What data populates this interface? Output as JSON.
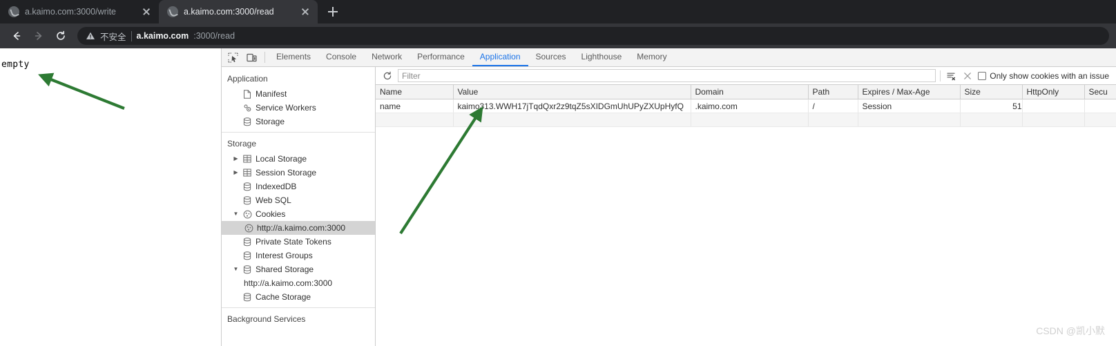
{
  "browser": {
    "tabs": [
      {
        "title": "a.kaimo.com:3000/write",
        "active": false,
        "favicon": "globe-icon"
      },
      {
        "title": "a.kaimo.com:3000/read",
        "active": true,
        "favicon": "globe-icon"
      }
    ],
    "new_tab_label": "+",
    "toolbar": {
      "back_label": "Back",
      "forward_label": "Forward",
      "reload_label": "Reload"
    },
    "omnibox": {
      "security_icon": "warning-triangle-icon",
      "security_label": "不安全",
      "url_host": "a.kaimo.com",
      "url_path": ":3000/read",
      "full_url": "a.kaimo.com:3000/read"
    }
  },
  "page": {
    "body_text": "empty"
  },
  "devtools": {
    "left_icons": [
      {
        "name": "inspect-element-icon"
      },
      {
        "name": "device-toolbar-icon"
      }
    ],
    "tabs": [
      {
        "label": "Elements",
        "active": false
      },
      {
        "label": "Console",
        "active": false
      },
      {
        "label": "Network",
        "active": false
      },
      {
        "label": "Performance",
        "active": false
      },
      {
        "label": "Application",
        "active": true
      },
      {
        "label": "Sources",
        "active": false
      },
      {
        "label": "Lighthouse",
        "active": false
      },
      {
        "label": "Memory",
        "active": false
      }
    ],
    "accent_color": "#1a73e8",
    "sidebar": {
      "sections": [
        {
          "title": "Application",
          "items": [
            {
              "label": "Manifest",
              "icon": "document-icon",
              "indent": 1,
              "twisty": "",
              "selected": false
            },
            {
              "label": "Service Workers",
              "icon": "gear-icon",
              "indent": 1,
              "twisty": "",
              "selected": false
            },
            {
              "label": "Storage",
              "icon": "database-icon",
              "indent": 1,
              "twisty": "",
              "selected": false
            }
          ]
        },
        {
          "title": "Storage",
          "items": [
            {
              "label": "Local Storage",
              "icon": "table-icon",
              "indent": 1,
              "twisty": "▶",
              "selected": false
            },
            {
              "label": "Session Storage",
              "icon": "table-icon",
              "indent": 1,
              "twisty": "▶",
              "selected": false
            },
            {
              "label": "IndexedDB",
              "icon": "database-icon",
              "indent": 1,
              "twisty": "",
              "selected": false
            },
            {
              "label": "Web SQL",
              "icon": "database-icon",
              "indent": 1,
              "twisty": "",
              "selected": false
            },
            {
              "label": "Cookies",
              "icon": "cookie-icon",
              "indent": 1,
              "twisty": "▼",
              "selected": false
            },
            {
              "label": "http://a.kaimo.com:3000",
              "icon": "cookie-icon",
              "indent": 2,
              "twisty": "",
              "selected": true
            },
            {
              "label": "Private State Tokens",
              "icon": "database-icon",
              "indent": 1,
              "twisty": "",
              "selected": false
            },
            {
              "label": "Interest Groups",
              "icon": "database-icon",
              "indent": 1,
              "twisty": "",
              "selected": false
            },
            {
              "label": "Shared Storage",
              "icon": "database-icon",
              "indent": 1,
              "twisty": "▼",
              "selected": false
            },
            {
              "label": "http://a.kaimo.com:3000",
              "icon": "",
              "indent": 2,
              "twisty": "",
              "selected": false
            },
            {
              "label": "Cache Storage",
              "icon": "database-icon",
              "indent": 1,
              "twisty": "",
              "selected": false
            }
          ]
        },
        {
          "title": "Background Services",
          "items": []
        }
      ]
    },
    "filterbar": {
      "refresh_icon": "refresh-icon",
      "filter_placeholder": "Filter",
      "filter_value": "",
      "clear_filters_icon": "clear-filters-icon",
      "close_icon": "close-icon",
      "issue_checkbox_checked": false,
      "issue_checkbox_label": "Only show cookies with an issue"
    },
    "cookie_table": {
      "columns": [
        "Name",
        "Value",
        "Domain",
        "Path",
        "Expires / Max-Age",
        "Size",
        "HttpOnly",
        "Secu"
      ],
      "rows": [
        {
          "Name": "name",
          "Value": "kaimo313.WWH17jTqdQxr2z9tqZ5sXIDGmUhUPyZXUpHyfQ",
          "Domain": ".kaimo.com",
          "Path": "/",
          "Expires / Max-Age": "Session",
          "Size": "51",
          "HttpOnly": "",
          "Secu": ""
        }
      ]
    }
  },
  "annotations": {
    "arrow_color": "#2d7a33",
    "arrows": [
      {
        "name": "arrow-to-empty-text"
      },
      {
        "name": "arrow-to-cookie-value"
      }
    ],
    "watermark": "CSDN @凯小默"
  }
}
